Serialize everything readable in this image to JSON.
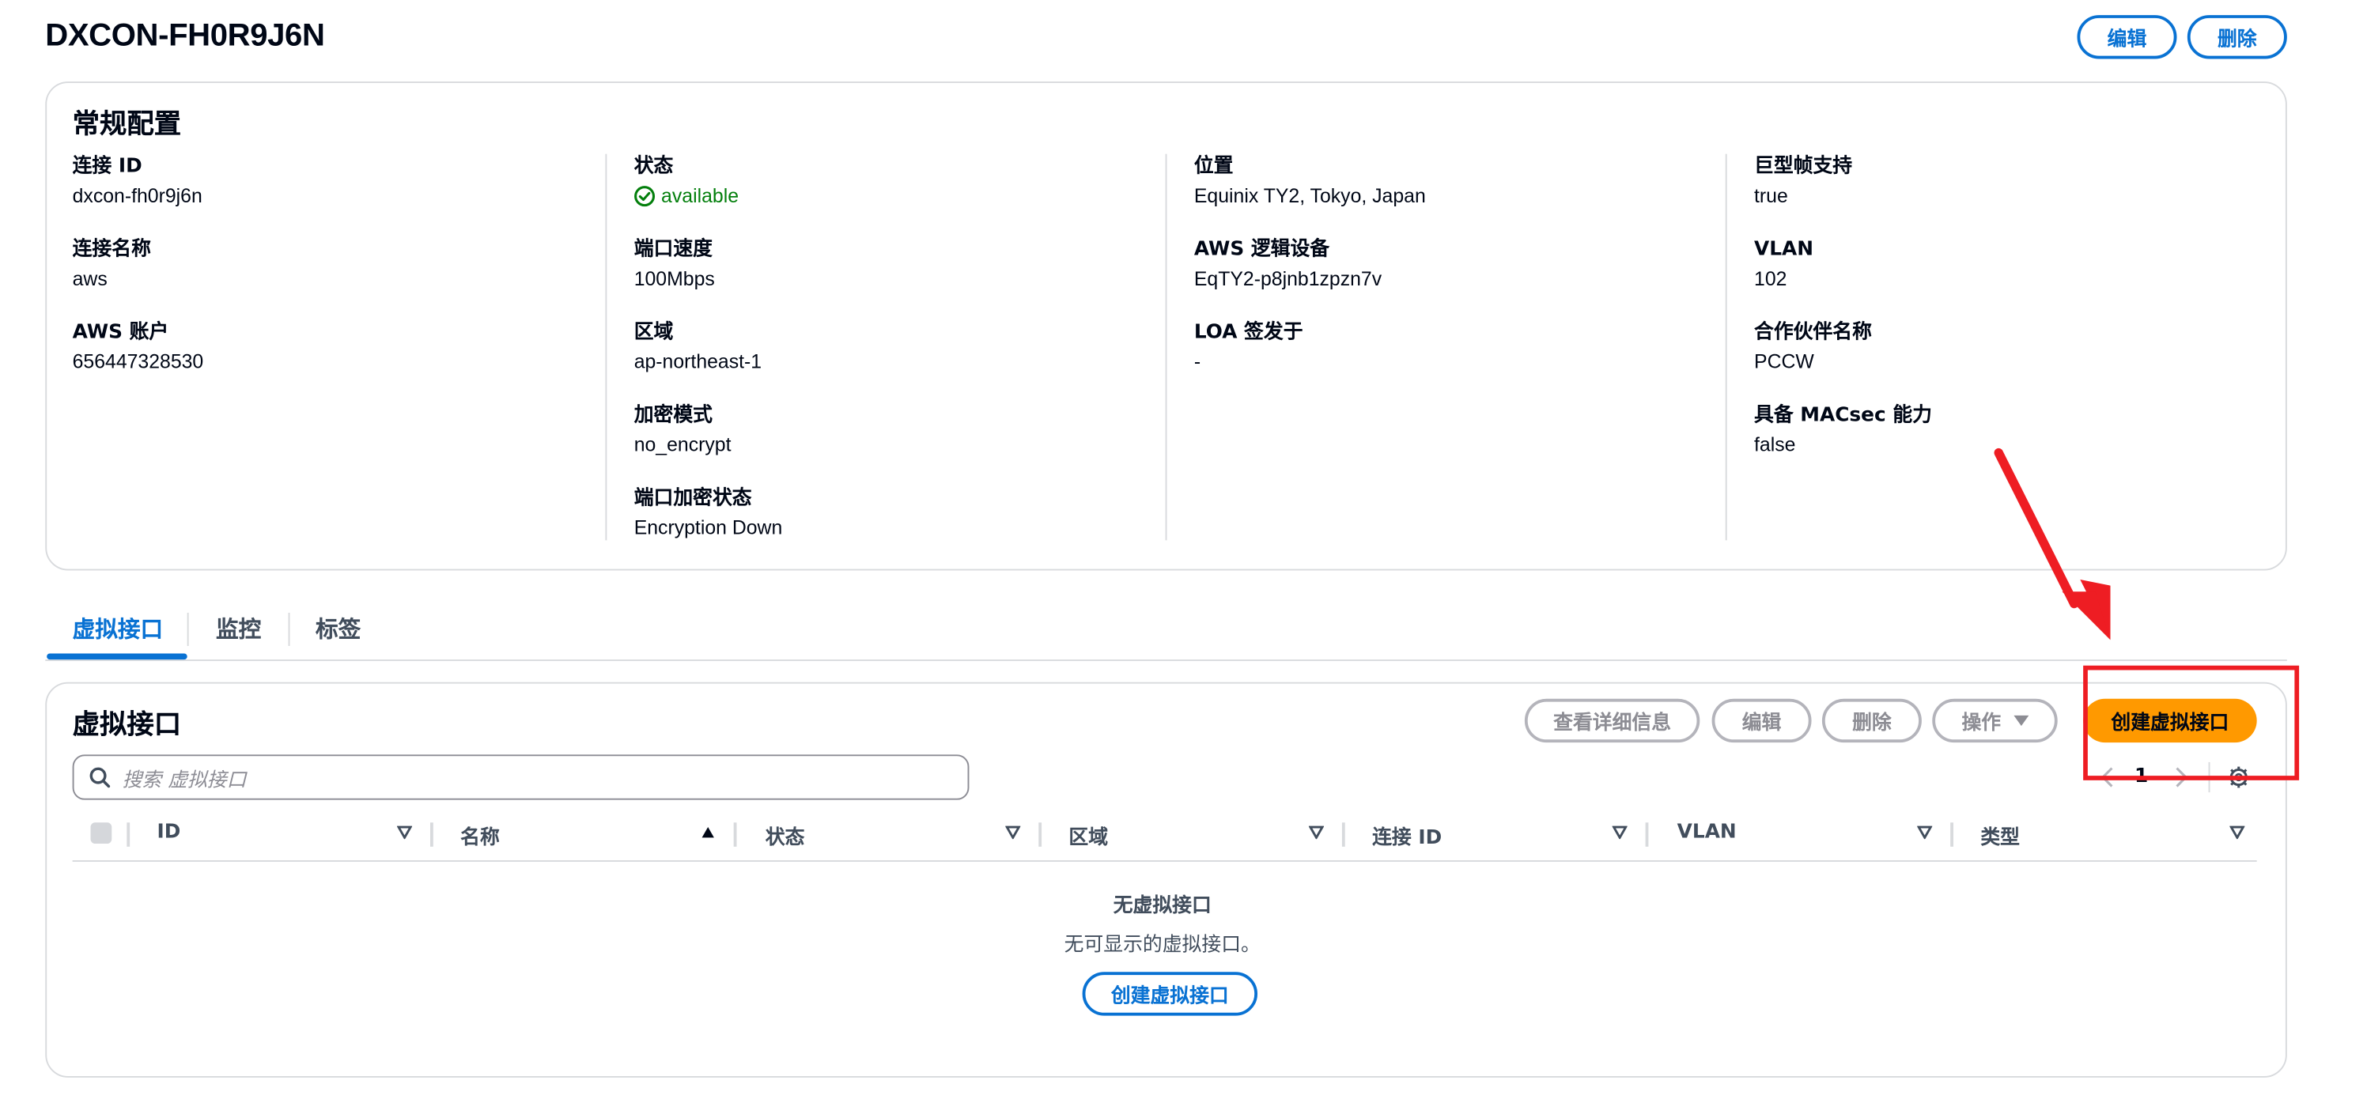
{
  "page": {
    "title": "DXCON-FH0R9J6N"
  },
  "header_actions": {
    "edit": "编辑",
    "delete": "删除"
  },
  "general": {
    "title": "常规配置",
    "col1": [
      {
        "label": "连接 ID",
        "value": "dxcon-fh0r9j6n"
      },
      {
        "label": "连接名称",
        "value": "aws"
      },
      {
        "label": "AWS 账户",
        "value": "656447328530"
      }
    ],
    "col2": [
      {
        "label": "状态",
        "value": "available"
      },
      {
        "label": "端口速度",
        "value": "100Mbps"
      },
      {
        "label": "区域",
        "value": "ap-northeast-1"
      },
      {
        "label": "加密模式",
        "value": "no_encrypt"
      },
      {
        "label": "端口加密状态",
        "value": "Encryption Down"
      }
    ],
    "col3": [
      {
        "label": "位置",
        "value": "Equinix TY2, Tokyo, Japan"
      },
      {
        "label": "AWS 逻辑设备",
        "value": "EqTY2-p8jnb1zpzn7v"
      },
      {
        "label": "LOA 签发于",
        "value": "-"
      }
    ],
    "col4": [
      {
        "label": "巨型帧支持",
        "value": "true"
      },
      {
        "label": "VLAN",
        "value": "102"
      },
      {
        "label": "合作伙伴名称",
        "value": "PCCW"
      },
      {
        "label": "具备 MACsec 能力",
        "value": "false"
      }
    ],
    "status_color": "#037f0c"
  },
  "tabs": [
    "虚拟接口",
    "监控",
    "标签"
  ],
  "vif": {
    "title": "虚拟接口",
    "actions": {
      "details": "查看详细信息",
      "edit": "编辑",
      "delete": "删除",
      "actions": "操作",
      "create": "创建虚拟接口"
    },
    "search_placeholder": "搜索 虚拟接口",
    "page_number": "1",
    "columns": [
      "ID",
      "名称",
      "状态",
      "区域",
      "连接 ID",
      "VLAN",
      "类型"
    ],
    "empty_title": "无虚拟接口",
    "empty_desc": "无可显示的虚拟接口。",
    "empty_create": "创建虚拟接口"
  },
  "colors": {
    "accent": "#0972d3",
    "primary_button": "#ff9900",
    "annotation": "#ee1d23"
  },
  "icons": [
    "check-circle-icon",
    "search-icon",
    "caret-down-icon",
    "sort-down-icon",
    "sort-up-icon",
    "chevron-left-icon",
    "chevron-right-icon",
    "gear-icon",
    "annotation-arrow"
  ]
}
